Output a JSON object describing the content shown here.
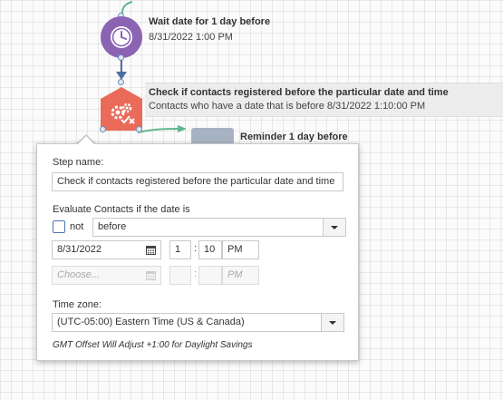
{
  "canvas": {
    "wait_node": {
      "title": "Wait date for 1 day before",
      "subtitle": "8/31/2022 1:00 PM",
      "icon": "clock-icon"
    },
    "check_node": {
      "title": "Check if contacts registered before the particular date and time",
      "subtitle": "Contacts who have a date that is before 8/31/2022 1:10:00 PM",
      "icon": "gears-check-icon"
    },
    "reminder_node": {
      "title": "Reminder 1 day before"
    },
    "colors": {
      "wait_node": "#8b63b3",
      "check_node": "#ea6b5a",
      "connector": "#4b6fa5",
      "branch": "#5fb78e"
    }
  },
  "dialog": {
    "step_name_label": "Step name:",
    "step_name_value": "Check if contacts registered before the particular date and time",
    "evaluate_label": "Evaluate Contacts if the date is",
    "not_label": "not",
    "not_checked": false,
    "operator_value": "before",
    "date1": {
      "date": "8/31/2022",
      "hour": "1",
      "minute": "10",
      "ampm": "PM"
    },
    "date2": {
      "placeholder": "Choose...",
      "ampm_placeholder": "PM"
    },
    "time_separator": ":",
    "timezone_label": "Time zone:",
    "timezone_value": "(UTC-05:00) Eastern Time (US & Canada)",
    "gmt_note": "GMT Offset Will Adjust +1:00 for Daylight Savings"
  }
}
